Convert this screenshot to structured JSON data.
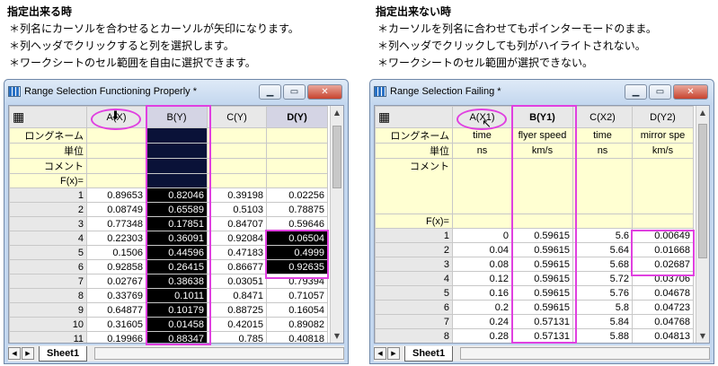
{
  "left_notes": {
    "heading": "指定出来る時",
    "lines": [
      "＊列名にカーソルを合わせるとカーソルが矢印になります。",
      "＊列ヘッダでクリックすると列を選択します。",
      "＊ワークシートのセル範囲を自由に選択できます。"
    ]
  },
  "right_notes": {
    "heading": "指定出来ない時",
    "lines": [
      "＊カーソルを列名に合わせてもポインターモードのまま。",
      "＊列ヘッダでクリックしても列がハイライトされない。",
      "＊ワークシートのセル範囲が選択できない。"
    ]
  },
  "left_window": {
    "title": "Range Selection Functioning Properly *",
    "columns": [
      "A(X)",
      "B(Y)",
      "C(Y)",
      "D(Y)"
    ],
    "meta_labels": [
      "ロングネーム",
      "単位",
      "コメント",
      "F(x)="
    ],
    "rows": [
      [
        "1",
        "0.89653",
        "0.82046",
        "0.39198",
        "0.02256"
      ],
      [
        "2",
        "0.08749",
        "0.65589",
        "0.5103",
        "0.78875"
      ],
      [
        "3",
        "0.77348",
        "0.17851",
        "0.84707",
        "0.59646"
      ],
      [
        "4",
        "0.22303",
        "0.36091",
        "0.92084",
        "0.06504"
      ],
      [
        "5",
        "0.1506",
        "0.44596",
        "0.47183",
        "0.4999"
      ],
      [
        "6",
        "0.92858",
        "0.26415",
        "0.86677",
        "0.92635"
      ],
      [
        "7",
        "0.02767",
        "0.38638",
        "0.03051",
        "0.79394"
      ],
      [
        "8",
        "0.33769",
        "0.1011",
        "0.8471",
        "0.71057"
      ],
      [
        "9",
        "0.64877",
        "0.10179",
        "0.88725",
        "0.16054"
      ],
      [
        "10",
        "0.31605",
        "0.01458",
        "0.42015",
        "0.89082"
      ],
      [
        "11",
        "0.19966",
        "0.88347",
        "0.785",
        "0.40818"
      ]
    ],
    "sheet_tab": "Sheet1"
  },
  "right_window": {
    "title": "Range Selection Failing *",
    "columns": [
      "A(X1)",
      "B(Y1)",
      "C(X2)",
      "D(Y2)"
    ],
    "meta_labels": [
      "ロングネーム",
      "単位",
      "コメント",
      "F(x)="
    ],
    "longnames": [
      "time",
      "flyer speed",
      "time",
      "mirror spe"
    ],
    "units": [
      "ns",
      "km/s",
      "ns",
      "km/s"
    ],
    "rows": [
      [
        "1",
        "0",
        "0.59615",
        "5.6",
        "0.00649"
      ],
      [
        "2",
        "0.04",
        "0.59615",
        "5.64",
        "0.01668"
      ],
      [
        "3",
        "0.08",
        "0.59615",
        "5.68",
        "0.02687"
      ],
      [
        "4",
        "0.12",
        "0.59615",
        "5.72",
        "0.03706"
      ],
      [
        "5",
        "0.16",
        "0.59615",
        "5.76",
        "0.04678"
      ],
      [
        "6",
        "0.2",
        "0.59615",
        "5.8",
        "0.04723"
      ],
      [
        "7",
        "0.24",
        "0.57131",
        "5.84",
        "0.04768"
      ],
      [
        "8",
        "0.28",
        "0.57131",
        "5.88",
        "0.04813"
      ]
    ],
    "sheet_tab": "Sheet1"
  },
  "icons": {
    "minimize": "minimize-icon",
    "maximize": "maximize-icon",
    "close": "close-icon"
  }
}
